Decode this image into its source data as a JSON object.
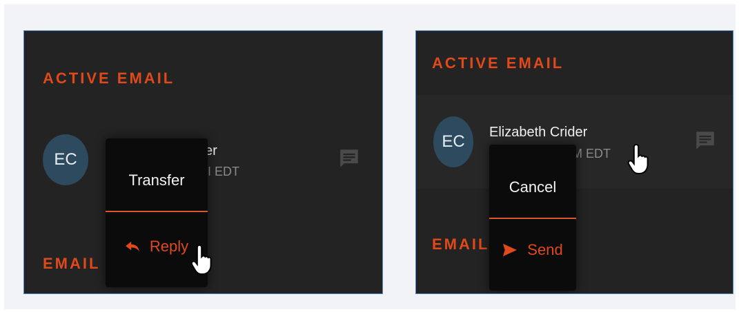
{
  "left_panel": {
    "active_heading": "ACTIVE EMAIL",
    "email_heading": "EMAIL",
    "contact": {
      "initials": "EC",
      "name_fragment": "er",
      "time_fragment": "I EDT"
    },
    "menu": {
      "top_label": "Transfer",
      "bottom_label": "Reply",
      "bottom_icon": "reply-icon"
    }
  },
  "right_panel": {
    "active_heading": "ACTIVE EMAIL",
    "email_heading": "EMAIL",
    "contact": {
      "initials": "EC",
      "name": "Elizabeth Crider",
      "time_fragment": "M EDT"
    },
    "menu": {
      "top_label": "Cancel",
      "bottom_label": "Send",
      "bottom_icon": "send-icon"
    }
  },
  "colors": {
    "accent": "#e0491a",
    "panel_bg": "#232323",
    "menu_bg": "#0b0b0b",
    "avatar_bg": "#2e4a5f",
    "panel_border": "#4a86c8"
  }
}
